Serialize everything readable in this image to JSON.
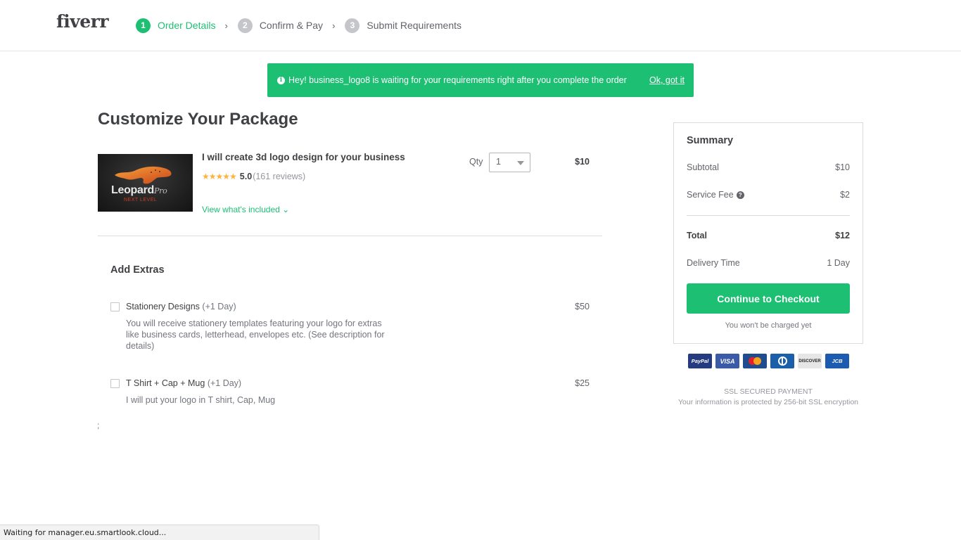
{
  "header": {
    "logo": "fiverr",
    "steps": [
      {
        "num": "1",
        "label": "Order Details",
        "active": true
      },
      {
        "num": "2",
        "label": "Confirm & Pay",
        "active": false
      },
      {
        "num": "3",
        "label": "Submit Requirements",
        "active": false
      }
    ],
    "chevron": "›"
  },
  "banner": {
    "icon": "i",
    "message": "Hey! business_logo8 is waiting for your requirements right after you complete the order",
    "link": "Ok, got it"
  },
  "main": {
    "title": "Customize Your Package",
    "gig": {
      "image_brand": "Leopard",
      "image_brand_suffix": "Pro",
      "image_tagline": "NEXT LEVEL",
      "title": "I will create 3d logo design for your business",
      "stars": "★★★★★",
      "rating": "5.0",
      "reviews": "(161 reviews)",
      "view_included": "View what's included ⌄",
      "qty_label": "Qty",
      "qty_value": "1",
      "price": "$10"
    },
    "extras_title": "Add Extras",
    "extras": [
      {
        "name": "Stationery Designs",
        "days": "(+1 Day)",
        "description": "You will receive stationery templates featuring your logo for extras like business cards, letterhead, envelopes etc. (See description for details)",
        "price": "$50",
        "checked": false
      },
      {
        "name": "T Shirt + Cap + Mug",
        "days": "(+1 Day)",
        "description": "I will put your logo in T shirt, Cap, Mug",
        "price": "$25",
        "checked": false
      }
    ],
    "stray_text": ";"
  },
  "summary": {
    "title": "Summary",
    "subtotal_label": "Subtotal",
    "subtotal": "$10",
    "service_fee_label": "Service Fee",
    "service_fee": "$2",
    "help_icon": "?",
    "total_label": "Total",
    "total": "$12",
    "delivery_label": "Delivery Time",
    "delivery": "1 Day",
    "checkout_button": "Continue to Checkout",
    "no_charge_note": "You won't be charged yet"
  },
  "payments": {
    "methods": [
      "PayPal",
      "VISA",
      "Maestro",
      "Diners Club",
      "DISCOVER",
      "JCB"
    ]
  },
  "ssl": {
    "title": "SSL SECURED PAYMENT",
    "note": "Your information is protected by 256-bit SSL encryption"
  },
  "statusbar": {
    "text": "Waiting for manager.eu.smartlook.cloud..."
  },
  "colors": {
    "brand_green": "#1dbf73",
    "text_dark": "#404145",
    "text_muted": "#74767e",
    "star": "#ffb33e"
  }
}
